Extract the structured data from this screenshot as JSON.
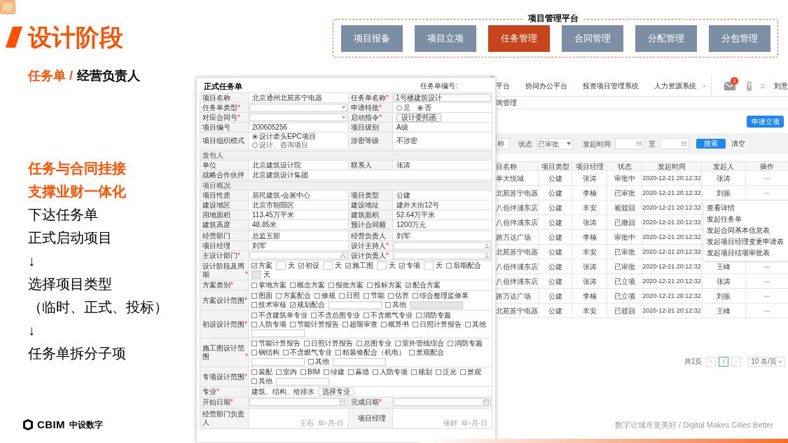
{
  "slide": {
    "title": "设计阶段",
    "subtitle_highlight": "任务单 /",
    "subtitle": "经营负责人",
    "points": [
      {
        "text": "任务与合同挂接",
        "highlight": true
      },
      {
        "text": "支撑业财一体化",
        "highlight": true
      },
      {
        "text": "下达任务单",
        "highlight": false
      },
      {
        "text": "正式启动项目",
        "highlight": false
      },
      {
        "text": "↓",
        "highlight": false
      },
      {
        "text": "选择项目类型",
        "highlight": false
      },
      {
        "text": "（临时、正式、投标）",
        "highlight": false
      },
      {
        "text": "↓",
        "highlight": false
      },
      {
        "text": "任务单拆分子项",
        "highlight": false
      }
    ],
    "logo_text": "CBIM",
    "logo_cn": "中设数字",
    "tagline": "数字让城市更美好 / Digital Makes Cities Better"
  },
  "platform": {
    "title": "项目管理平台",
    "tabs": [
      {
        "label": "项目报备",
        "selected": false
      },
      {
        "label": "项目立项",
        "selected": false
      },
      {
        "label": "任务管理",
        "selected": true
      },
      {
        "label": "合同管理",
        "selected": false
      },
      {
        "label": "分配管理",
        "selected": false
      },
      {
        "label": "分包管理",
        "selected": false
      }
    ]
  },
  "list_screen": {
    "nav": [
      "平台",
      "协同办公平台",
      "投资项目管理系统",
      "人力资源系统"
    ],
    "mail_badge": "3",
    "help_glyph": "?",
    "user": "刘意",
    "breadcrumb": "询管理",
    "apply_button": "申请立项",
    "filter": {
      "name_value": "称",
      "status_label": "状态",
      "status_value": "已审批",
      "time_label": "发起时间",
      "to_label": "至",
      "search_button": "搜索",
      "clear_button": "清空"
    },
    "columns": [
      "目名称",
      "项目类型",
      "项目经理",
      "状态",
      "发起时间",
      "发起人",
      "操作"
    ],
    "rows": [
      {
        "name": "单大悦城",
        "type": "公建",
        "manager": "张涛",
        "status": "审批中",
        "time": "2020-12-21   20:12:32",
        "initiator": "张涛",
        "ops": "•••"
      },
      {
        "name": "北苑苏宁电器",
        "type": "公建",
        "manager": "李楠",
        "status": "已审批",
        "time": "2020-12-21   20:12:32",
        "initiator": "刘振",
        "ops": "•••"
      },
      {
        "name": "八佰伴浦东店",
        "type": "公建",
        "manager": "丰安",
        "status": "被驳回",
        "time": "2020-12-21   20:12:32"
      },
      {
        "name": "八佰伴浦东店",
        "type": "公建",
        "manager": "张涛",
        "status": "已撤回",
        "time": "2020-12-21   20:12:32"
      },
      {
        "name": "路万达广场",
        "type": "公建",
        "manager": "李楠",
        "status": "审批中",
        "time": "2020-12-21   20:12:32"
      },
      {
        "name": "北苑苏宁电器",
        "type": "公建",
        "manager": "丰安",
        "status": "已审批",
        "time": "2020-12-21   20:12:32"
      },
      {
        "name": "八佰伴浦东店",
        "type": "公建",
        "manager": "张涛",
        "status": "已审批",
        "time": "2020-12-21   20:12:32",
        "initiator": "王峰",
        "ops": "•••"
      },
      {
        "name": "八佰伴浦东店",
        "type": "公建",
        "manager": "张涛",
        "status": "已立项",
        "time": "2020-12-21   20:12:32",
        "initiator": "张涛",
        "ops": "•••"
      },
      {
        "name": "路万达广场",
        "type": "公建",
        "manager": "李楠",
        "status": "已立项",
        "time": "2020-12-21   20:12:32",
        "initiator": "刘振",
        "ops": "•••"
      },
      {
        "name": "北苑苏宁电器",
        "type": "公建",
        "manager": "丰安",
        "status": "已驳回",
        "time": "2020-12-21   20:12:32",
        "initiator": "王峰",
        "ops": "•••"
      }
    ],
    "menu": [
      "查看详情",
      "发起任务单",
      "发起合同基本信息表",
      "发起项目经理变更申请表",
      "发起项目结项审批表"
    ],
    "pagination": {
      "total": "共1页",
      "prev": "<",
      "page": "1",
      "next": ">",
      "page_size": "10 条/页"
    }
  },
  "form": {
    "title": "正式任务单",
    "number_label": "任务单编号:",
    "sections": [
      {
        "rows": [
          [
            {
              "kind": "label",
              "text": "项目名称"
            },
            {
              "kind": "text",
              "text": "北京通州北苑苏宁电器"
            },
            {
              "kind": "label",
              "text": "任务单名称",
              "mark": "*"
            },
            {
              "kind": "input",
              "value": "1号楼建筑设计"
            }
          ],
          [
            {
              "kind": "label",
              "text": "任务单类型",
              "mark": "*"
            },
            {
              "kind": "select"
            },
            {
              "kind": "label",
              "text": "申请特批",
              "mark": "*"
            },
            {
              "kind": "radios",
              "options": [
                {
                  "label": "是",
                  "selected": false
                },
                {
                  "label": "否",
                  "selected": true
                }
              ]
            }
          ],
          [
            {
              "kind": "label",
              "text": "对应合同号",
              "mark": "*"
            },
            {
              "kind": "select"
            },
            {
              "kind": "label",
              "text": "启动指令",
              "mark": "*"
            },
            {
              "kind": "button",
              "text": "设计委托函"
            }
          ],
          [
            {
              "kind": "label",
              "text": "项目编号"
            },
            {
              "kind": "text",
              "text": "200605256"
            },
            {
              "kind": "label",
              "text": "项目级别"
            },
            {
              "kind": "text",
              "text": "A级"
            }
          ],
          [
            {
              "kind": "label",
              "text": "项目组织模式"
            },
            {
              "kind": "radios",
              "options": [
                {
                  "label": "设计牵头EPC项目",
                  "selected": true
                },
                {
                  "label": "设计、咨询项目",
                  "selected": false
                }
              ]
            },
            {
              "kind": "label",
              "text": "涉密等级"
            },
            {
              "kind": "text",
              "text": "不涉密"
            }
          ]
        ]
      },
      {
        "header": "发包人",
        "rows": [
          [
            {
              "kind": "label",
              "text": "单位"
            },
            {
              "kind": "text",
              "text": "北京建筑设计院"
            },
            {
              "kind": "label",
              "text": "联系人"
            },
            {
              "kind": "text",
              "text": "张涛"
            }
          ],
          [
            {
              "kind": "label",
              "text": "战略合作伙伴"
            },
            {
              "kind": "text",
              "text": "北京建筑设计集团"
            }
          ]
        ]
      },
      {
        "header": "项目概况",
        "rows": [
          [
            {
              "kind": "label",
              "text": "项目性质"
            },
            {
              "kind": "text",
              "text": "居民建筑-会展中心"
            },
            {
              "kind": "label",
              "text": "项目类型"
            },
            {
              "kind": "text",
              "text": "公建"
            }
          ],
          [
            {
              "kind": "label",
              "text": "建设地区"
            },
            {
              "kind": "text",
              "text": "北京市朝阳区"
            },
            {
              "kind": "label",
              "text": "建设地址"
            },
            {
              "kind": "text",
              "text": "建外大街12号"
            }
          ],
          [
            {
              "kind": "label",
              "text": "用地面积"
            },
            {
              "kind": "text",
              "text": "113.45万平米"
            },
            {
              "kind": "label",
              "text": "建筑面积"
            },
            {
              "kind": "text",
              "text": "52.64万平米"
            }
          ],
          [
            {
              "kind": "label",
              "text": "建筑高度"
            },
            {
              "kind": "text",
              "text": "48.85米"
            },
            {
              "kind": "label",
              "text": "预计合同额"
            },
            {
              "kind": "text",
              "text": "1200万元"
            }
          ]
        ]
      },
      {
        "rows": [
          [
            {
              "kind": "label",
              "text": "经营部门"
            },
            {
              "kind": "text",
              "text": "总监五部"
            },
            {
              "kind": "label",
              "text": "经营负责人"
            },
            {
              "kind": "text",
              "text": "刘军"
            }
          ],
          [
            {
              "kind": "label",
              "text": "项目经理"
            },
            {
              "kind": "text",
              "text": "刘军"
            },
            {
              "kind": "label",
              "text": "设计主持人",
              "mark": "*"
            },
            {
              "kind": "person"
            }
          ],
          [
            {
              "kind": "label",
              "text": "主设计部门",
              "mark": "*"
            },
            {
              "kind": "org"
            },
            {
              "kind": "label",
              "text": "设计负责人",
              "mark": "*"
            },
            {
              "kind": "person"
            }
          ],
          [
            {
              "kind": "label",
              "text": "设计阶段及周期",
              "mark": "*"
            },
            {
              "kind": "items",
              "items": [
                {
                  "kind": "check",
                  "label": "方案",
                  "checked": true
                },
                {
                  "kind": "days",
                  "unit": "天",
                  "disabled": false
                },
                {
                  "kind": "check",
                  "label": "初设",
                  "checked": true
                },
                {
                  "kind": "days",
                  "unit": "天",
                  "disabled": false
                },
                {
                  "kind": "check",
                  "label": "施工图",
                  "checked": true
                },
                {
                  "kind": "days",
                  "unit": "天",
                  "disabled": false
                },
                {
                  "kind": "check",
                  "label": "专项",
                  "checked": true
                },
                {
                  "kind": "days",
                  "unit": "天",
                  "disabled": false
                },
                {
                  "kind": "check",
                  "label": "后期配合",
                  "checked": false
                },
                {
                  "kind": "days",
                  "unit": "天",
                  "disabled": true
                }
              ]
            }
          ],
          [
            {
              "kind": "label",
              "text": "方案类别",
              "mark": "*"
            },
            {
              "kind": "items",
              "items": [
                {
                  "kind": "check",
                  "label": "拿地方案",
                  "checked": false
                },
                {
                  "kind": "check",
                  "label": "概念方案",
                  "checked": false
                },
                {
                  "kind": "check",
                  "label": "报批方案",
                  "checked": false
                },
                {
                  "kind": "check",
                  "label": "投标方案",
                  "checked": false
                },
                {
                  "kind": "check",
                  "label": "配合方案",
                  "checked": true
                }
              ]
            }
          ],
          [
            {
              "kind": "label",
              "text": "方案设计范围",
              "mark": "*"
            },
            {
              "kind": "items",
              "items": [
                {
                  "kind": "check",
                  "label": "图面",
                  "checked": false
                },
                {
                  "kind": "check",
                  "label": "方案配合",
                  "checked": false
                },
                {
                  "kind": "check",
                  "label": "修规",
                  "checked": false
                },
                {
                  "kind": "check",
                  "label": "日照",
                  "checked": false
                },
                {
                  "kind": "check",
                  "label": "节能",
                  "checked": false
                },
                {
                  "kind": "check",
                  "label": "估算",
                  "checked": false
                },
                {
                  "kind": "check",
                  "label": "综合整理监修果",
                  "checked": false
                },
                {
                  "kind": "check",
                  "label": "技术审核",
                  "checked": false
                },
                {
                  "kind": "check",
                  "label": "规划配合",
                  "checked": true
                },
                {
                  "kind": "field",
                  "disabled": false
                },
                {
                  "kind": "check",
                  "label": "其他",
                  "checked": false
                },
                {
                  "kind": "field",
                  "disabled": true
                }
              ]
            }
          ],
          [
            {
              "kind": "label",
              "text": "初设设计范围",
              "mark": "*"
            },
            {
              "kind": "items",
              "items": [
                {
                  "kind": "check",
                  "label": "不含建筑单专业",
                  "checked": false
                },
                {
                  "kind": "check",
                  "label": "不含总图专业",
                  "checked": false
                },
                {
                  "kind": "check",
                  "label": "不含燃气专业",
                  "checked": false
                },
                {
                  "kind": "check",
                  "label": "消防专篇",
                  "checked": false
                },
                {
                  "kind": "check",
                  "label": "人防专项",
                  "checked": false
                },
                {
                  "kind": "check",
                  "label": "节能计算报告",
                  "checked": false
                },
                {
                  "kind": "check",
                  "label": "超限审查",
                  "checked": false
                },
                {
                  "kind": "check",
                  "label": "概算书",
                  "checked": false
                },
                {
                  "kind": "check",
                  "label": "日照计算报告",
                  "checked": false
                },
                {
                  "kind": "check",
                  "label": "其他",
                  "checked": false
                },
                {
                  "kind": "field",
                  "disabled": false
                }
              ]
            }
          ],
          [
            {
              "kind": "label",
              "text": "施工图设计范围",
              "mark": "*"
            },
            {
              "kind": "items",
              "items": [
                {
                  "kind": "check",
                  "label": "节能计算报告",
                  "checked": false
                },
                {
                  "kind": "check",
                  "label": "日照计算报告",
                  "checked": false
                },
                {
                  "kind": "check",
                  "label": "总图专业",
                  "checked": false
                },
                {
                  "kind": "check",
                  "label": "室外管线综合",
                  "checked": false
                },
                {
                  "kind": "check",
                  "label": "消防专篇",
                  "checked": false
                },
                {
                  "kind": "check",
                  "label": "钢结构",
                  "checked": false
                },
                {
                  "kind": "check",
                  "label": "不含燃气专业",
                  "checked": false
                },
                {
                  "kind": "check",
                  "label": "精装修配合（机电）",
                  "checked": false
                },
                {
                  "kind": "check",
                  "label": "景观配合",
                  "checked": false
                },
                {
                  "kind": "field",
                  "disabled": false
                },
                {
                  "kind": "check",
                  "label": "其他",
                  "checked": false
                },
                {
                  "kind": "field",
                  "disabled": false
                }
              ]
            }
          ],
          [
            {
              "kind": "label",
              "text": "专项设计范围",
              "mark": "*"
            },
            {
              "kind": "items",
              "items": [
                {
                  "kind": "check",
                  "label": "装配",
                  "checked": false
                },
                {
                  "kind": "check",
                  "label": "室内",
                  "checked": false
                },
                {
                  "kind": "check",
                  "label": "BIM",
                  "checked": false
                },
                {
                  "kind": "check",
                  "label": "绿建",
                  "checked": false
                },
                {
                  "kind": "check",
                  "label": "幕墙",
                  "checked": false
                },
                {
                  "kind": "check",
                  "label": "人防专项",
                  "checked": false
                },
                {
                  "kind": "check",
                  "label": "规划",
                  "checked": false
                },
                {
                  "kind": "check",
                  "label": "泛光",
                  "checked": false
                },
                {
                  "kind": "check",
                  "label": "景观",
                  "checked": false
                },
                {
                  "kind": "check",
                  "label": "其他",
                  "checked": false
                },
                {
                  "kind": "field",
                  "disabled": false
                }
              ]
            }
          ],
          [
            {
              "kind": "label",
              "text": "专业",
              "mark": "*"
            },
            {
              "kind": "items",
              "items": [
                {
                  "kind": "text",
                  "text": "建筑、结构、给排水"
                },
                {
                  "kind": "button",
                  "text": "选择专业"
                }
              ]
            }
          ],
          [
            {
              "kind": "label",
              "text": "开始日期",
              "mark": "*"
            },
            {
              "kind": "date"
            },
            {
              "kind": "label",
              "text": "完成日期",
              "mark": "*"
            },
            {
              "kind": "date"
            }
          ]
        ]
      },
      {
        "rows": [
          [
            {
              "kind": "label",
              "text": "经营部门负责人"
            },
            {
              "kind": "sign",
              "signer": "王石",
              "date": "年-月-日"
            },
            {
              "kind": "label",
              "text": "项目经理"
            },
            {
              "kind": "sign",
              "signer": "张好",
              "date": "年-月-日"
            }
          ]
        ]
      }
    ]
  }
}
